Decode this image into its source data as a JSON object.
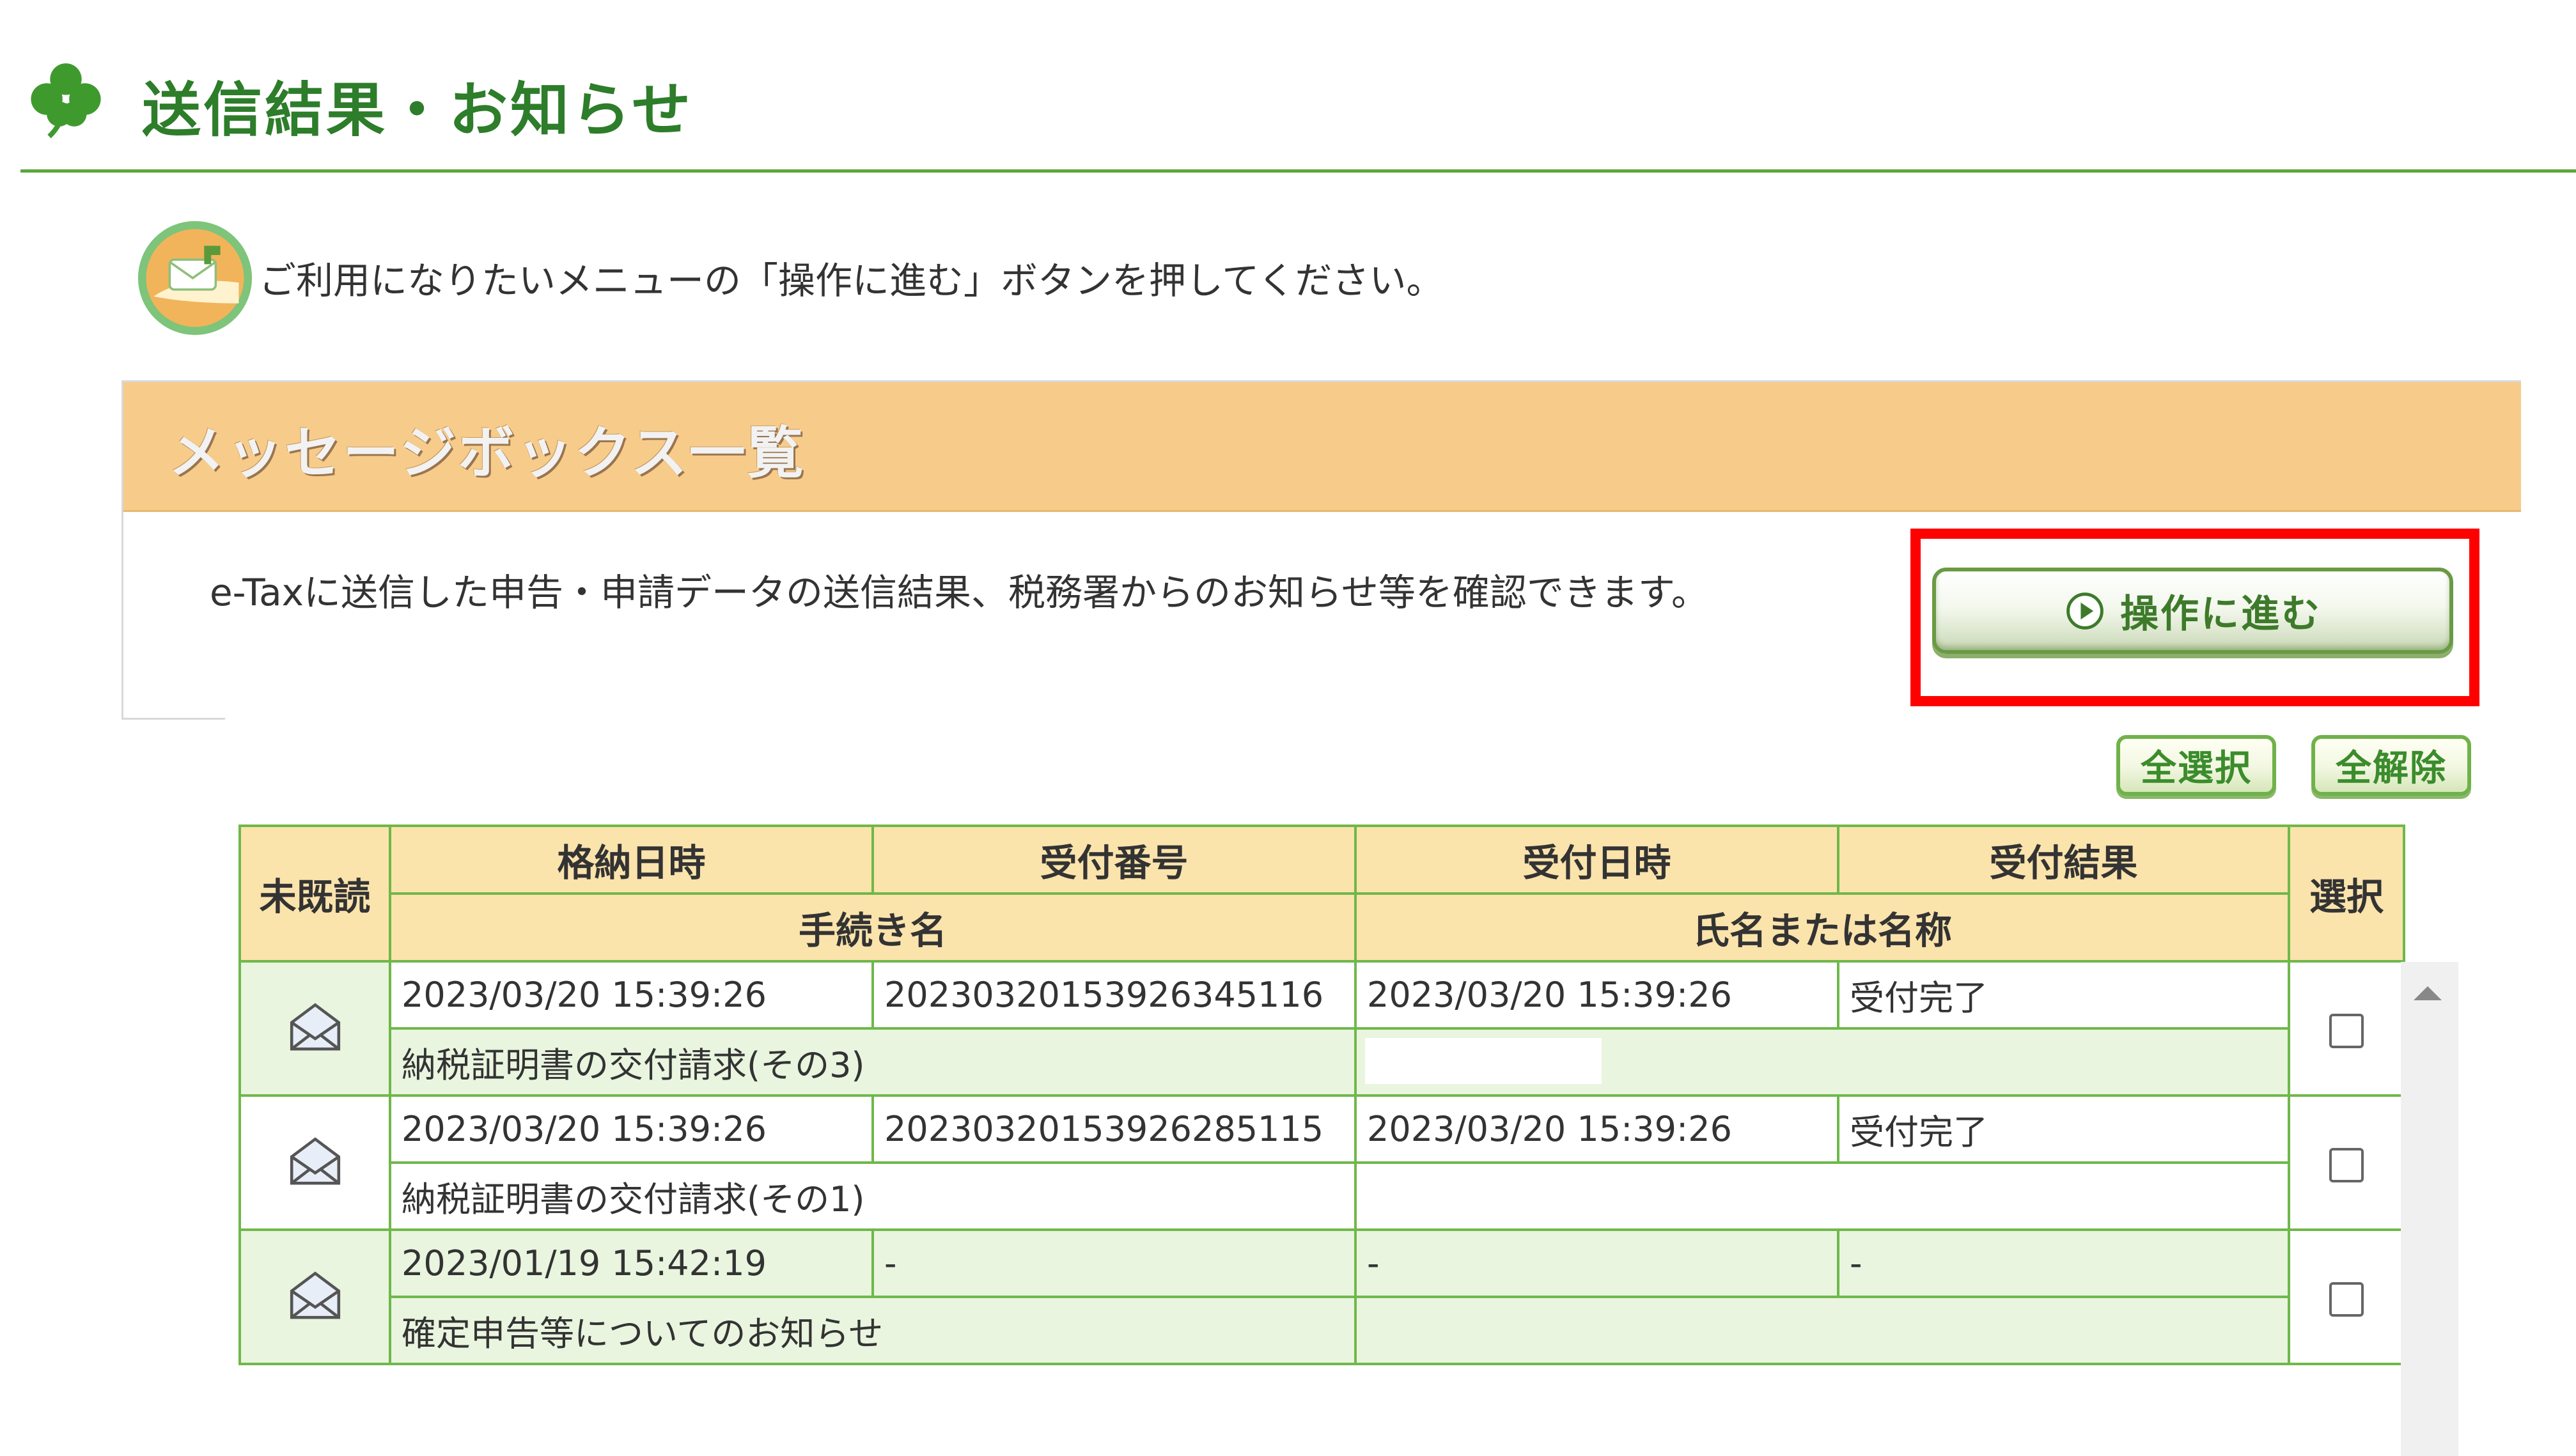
{
  "header": {
    "title": "送信結果・お知らせ"
  },
  "instruction": {
    "text": "ご利用になりたいメニューの「操作に進む」ボタンを押してください。"
  },
  "message_box": {
    "title": "メッセージボックス一覧",
    "description": "e-Taxに送信した申告・申請データの送信結果、税務署からのお知らせ等を確認できます。",
    "proceed_label": "操作に進む"
  },
  "actions": {
    "select_all": "全選択",
    "deselect_all": "全解除"
  },
  "table": {
    "headers": {
      "unread": "未既読",
      "stored_datetime": "格納日時",
      "receipt_number": "受付番号",
      "receipt_datetime": "受付日時",
      "receipt_result": "受付結果",
      "procedure_name": "手続き名",
      "name": "氏名または名称",
      "select": "選択"
    },
    "rows": [
      {
        "stored_datetime": "2023/03/20 15:39:26",
        "receipt_number": "20230320153926345116",
        "receipt_datetime": "2023/03/20 15:39:26",
        "receipt_result": "受付完了",
        "procedure_name": "納税証明書の交付請求(その3)",
        "name": ""
      },
      {
        "stored_datetime": "2023/03/20 15:39:26",
        "receipt_number": "20230320153926285115",
        "receipt_datetime": "2023/03/20 15:39:26",
        "receipt_result": "受付完了",
        "procedure_name": "納税証明書の交付請求(その1)",
        "name": ""
      },
      {
        "stored_datetime": "2023/01/19 15:42:19",
        "receipt_number": "-",
        "receipt_datetime": "-",
        "receipt_result": "-",
        "procedure_name": "確定申告等についてのお知らせ",
        "name": ""
      }
    ]
  },
  "colors": {
    "title_green": "#2d7d2a",
    "rule_green": "#5aa83a",
    "panel_orange": "#f7cc8a",
    "table_header": "#fbe3ac",
    "row_green": "#e9f5df",
    "highlight_red": "#ff0000"
  },
  "icons": {
    "title": "clover-icon",
    "instruction": "guide-mail-icon",
    "row": "envelope-icon",
    "proceed": "play-circle-icon"
  }
}
